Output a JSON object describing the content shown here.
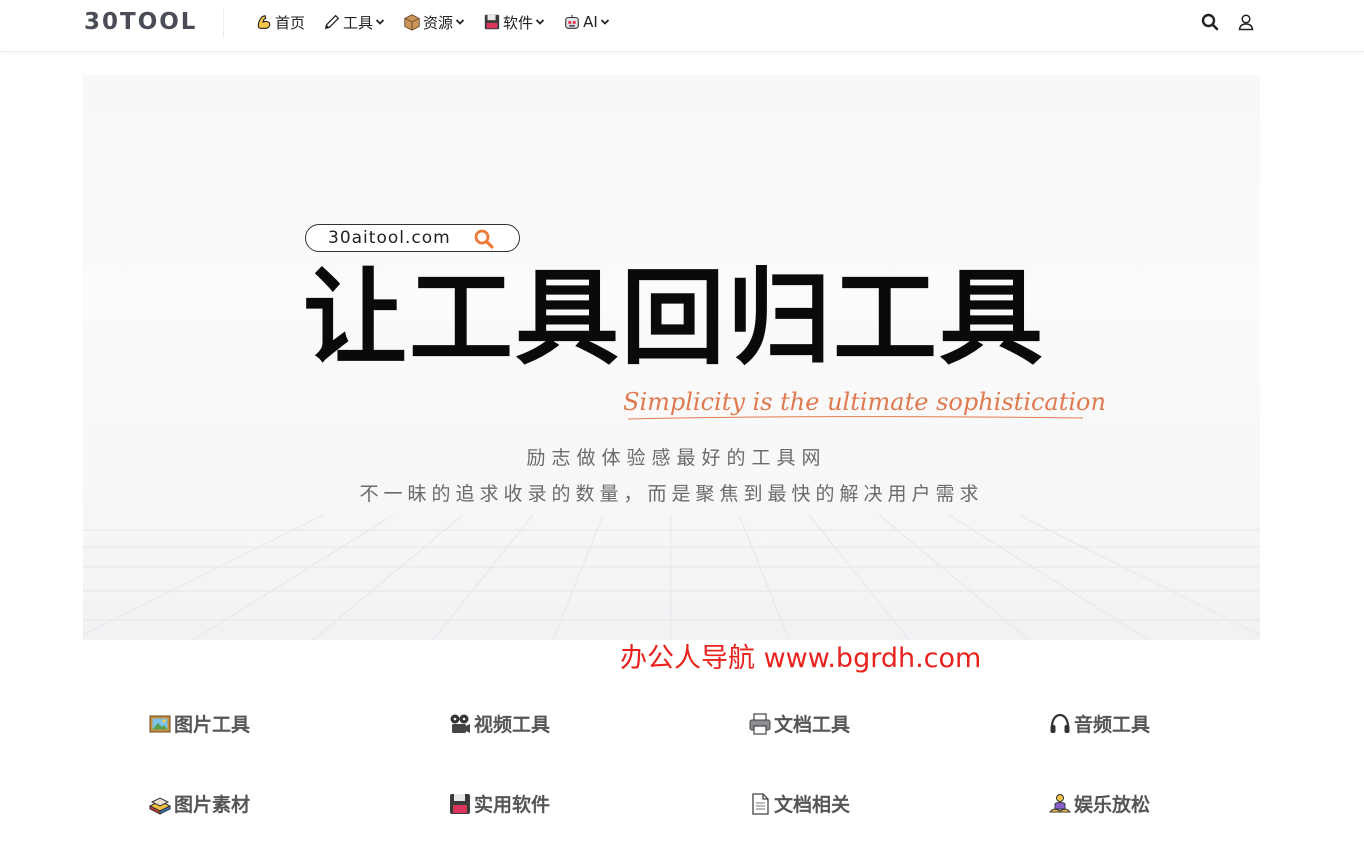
{
  "header": {
    "logo": "30TOOL",
    "nav": [
      {
        "label": "首页",
        "icon": "flexed-arm-icon",
        "has_dropdown": false
      },
      {
        "label": "工具",
        "icon": "pencil-icon",
        "has_dropdown": true
      },
      {
        "label": "资源",
        "icon": "package-icon",
        "has_dropdown": true
      },
      {
        "label": "软件",
        "icon": "floppy-disk-icon",
        "has_dropdown": true
      },
      {
        "label": "AI",
        "icon": "robot-icon",
        "has_dropdown": true
      }
    ],
    "right_icons": [
      "search-icon",
      "user-icon"
    ]
  },
  "banner": {
    "search_pill_text": "30aitool.com",
    "headline": "让工具回归工具",
    "tagline": "Simplicity is the ultimate sophistication",
    "subtitle1": "励志做体验感最好的工具网",
    "subtitle2": "不一昧的追求收录的数量，而是聚焦到最快的解决用户需求"
  },
  "watermark": "办公人导航 www.bgrdh.com",
  "categories": [
    {
      "label": "图片工具",
      "icon": "framed-picture-icon"
    },
    {
      "label": "视频工具",
      "icon": "film-projector-icon"
    },
    {
      "label": "文档工具",
      "icon": "printer-icon"
    },
    {
      "label": "音频工具",
      "icon": "headphones-icon"
    },
    {
      "label": "图片素材",
      "icon": "books-icon"
    },
    {
      "label": "实用软件",
      "icon": "floppy-disk-icon"
    },
    {
      "label": "文档相关",
      "icon": "page-icon"
    },
    {
      "label": "娱乐放松",
      "icon": "meditation-icon"
    }
  ],
  "colors": {
    "accent_orange": "#e07a4e",
    "watermark_red": "#e8231e",
    "logo_gray": "#4a4d57"
  }
}
